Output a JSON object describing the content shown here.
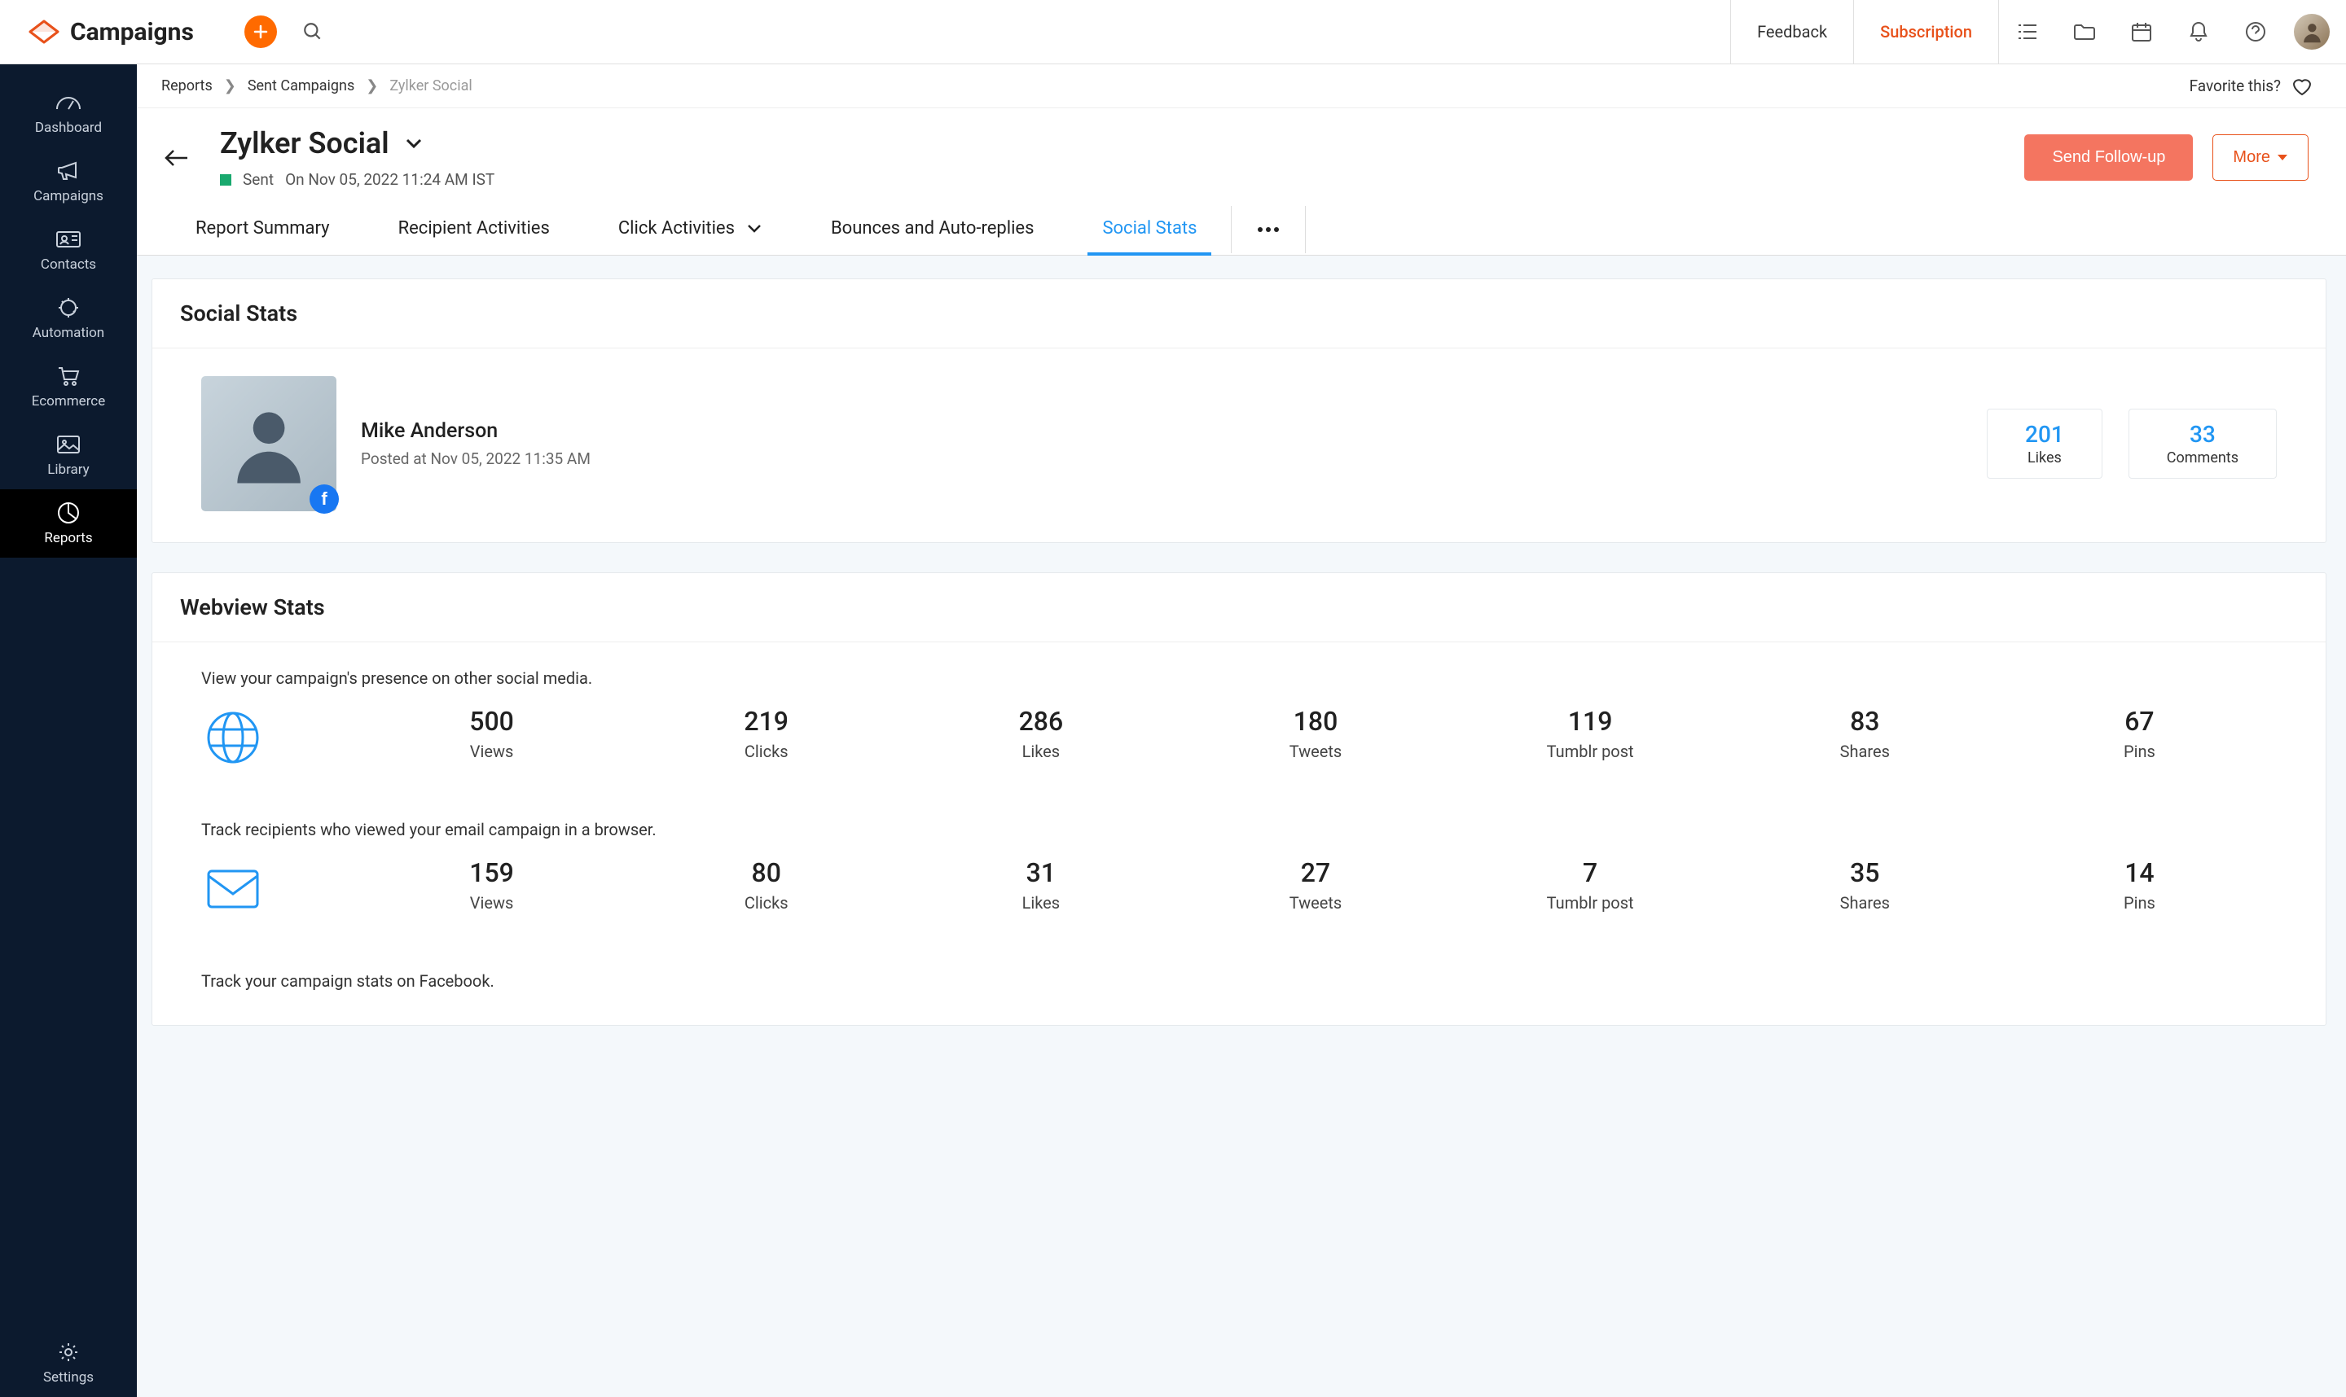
{
  "header": {
    "app_name": "Campaigns",
    "feedback_label": "Feedback",
    "subscription_label": "Subscription"
  },
  "sidebar": {
    "items": [
      {
        "label": "Dashboard"
      },
      {
        "label": "Campaigns"
      },
      {
        "label": "Contacts"
      },
      {
        "label": "Automation"
      },
      {
        "label": "Ecommerce"
      },
      {
        "label": "Library"
      },
      {
        "label": "Reports"
      }
    ],
    "settings_label": "Settings"
  },
  "breadcrumb": {
    "l1": "Reports",
    "l2": "Sent Campaigns",
    "l3": "Zylker Social",
    "favorite_label": "Favorite this?"
  },
  "campaign": {
    "title": "Zylker Social",
    "status": "Sent",
    "sent_time": "On Nov 05, 2022  11:24 AM IST",
    "follow_up_label": "Send Follow-up",
    "more_label": "More"
  },
  "tabs": {
    "summary": "Report Summary",
    "recipient": "Recipient Activities",
    "click": "Click Activities",
    "bounces": "Bounces and Auto-replies",
    "social": "Social Stats"
  },
  "social_stats": {
    "title": "Social Stats",
    "poster_name": "Mike Anderson",
    "posted_at": "Posted at Nov 05, 2022  11:35 AM",
    "likes": {
      "value": "201",
      "label": "Likes"
    },
    "comments": {
      "value": "33",
      "label": "Comments"
    }
  },
  "webview": {
    "title": "Webview Stats",
    "rows": [
      {
        "desc": "View your campaign's presence on other social media.",
        "icon": "globe",
        "stats": [
          {
            "n": "500",
            "l": "Views"
          },
          {
            "n": "219",
            "l": "Clicks"
          },
          {
            "n": "286",
            "l": "Likes"
          },
          {
            "n": "180",
            "l": "Tweets"
          },
          {
            "n": "119",
            "l": "Tumblr post"
          },
          {
            "n": "83",
            "l": "Shares"
          },
          {
            "n": "67",
            "l": "Pins"
          }
        ]
      },
      {
        "desc": "Track recipients who viewed your email campaign in a browser.",
        "icon": "mail",
        "stats": [
          {
            "n": "159",
            "l": "Views"
          },
          {
            "n": "80",
            "l": "Clicks"
          },
          {
            "n": "31",
            "l": "Likes"
          },
          {
            "n": "27",
            "l": "Tweets"
          },
          {
            "n": "7",
            "l": "Tumblr post"
          },
          {
            "n": "35",
            "l": "Shares"
          },
          {
            "n": "14",
            "l": "Pins"
          }
        ]
      },
      {
        "desc": "Track your campaign stats on Facebook.",
        "icon": "facebook",
        "stats": []
      }
    ]
  }
}
